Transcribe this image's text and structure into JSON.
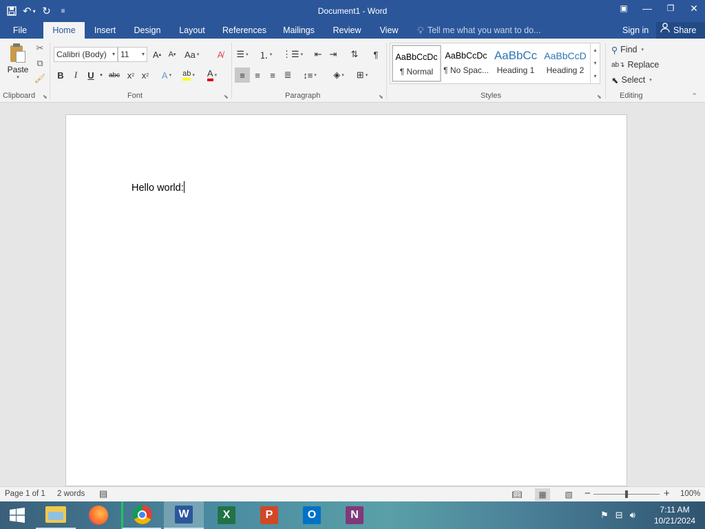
{
  "window": {
    "title": "Document1 - Word"
  },
  "tabs": [
    {
      "label": "File"
    },
    {
      "label": "Home"
    },
    {
      "label": "Insert"
    },
    {
      "label": "Design"
    },
    {
      "label": "Layout"
    },
    {
      "label": "References"
    },
    {
      "label": "Mailings"
    },
    {
      "label": "Review"
    },
    {
      "label": "View"
    }
  ],
  "active_tab": "Home",
  "tell_me": {
    "placeholder": "Tell me what you want to do..."
  },
  "account": {
    "sign_in": "Sign in",
    "share": "Share"
  },
  "ribbon": {
    "clipboard": {
      "paste_label": "Paste",
      "group_label": "Clipboard"
    },
    "font": {
      "family": "Calibri (Body)",
      "size": "11",
      "group_label": "Font",
      "change_case": "Aa"
    },
    "paragraph": {
      "group_label": "Paragraph"
    },
    "styles": {
      "group_label": "Styles",
      "items": [
        {
          "preview": "AaBbCcDc",
          "name": "¶ Normal",
          "color": "#000000"
        },
        {
          "preview": "AaBbCcDc",
          "name": "¶ No Spac...",
          "color": "#000000"
        },
        {
          "preview": "AaBbCc",
          "name": "Heading 1",
          "color": "#2e74b5"
        },
        {
          "preview": "AaBbCcD",
          "name": "Heading 2",
          "color": "#2e74b5"
        }
      ]
    },
    "editing": {
      "group_label": "Editing",
      "find": "Find",
      "replace": "Replace",
      "select": "Select"
    }
  },
  "document": {
    "text": "Hello world:"
  },
  "status": {
    "page": "Page 1 of 1",
    "words": "2 words",
    "zoom": "100%"
  },
  "taskbar": {
    "apps": [
      {
        "name": "File Explorer",
        "icon": "folder-icon"
      },
      {
        "name": "Firefox",
        "icon": "firefox-icon"
      },
      {
        "name": "Chrome",
        "icon": "chrome-icon"
      },
      {
        "name": "Word",
        "icon": "word-icon",
        "letter": "W",
        "color": "#2b579a"
      },
      {
        "name": "Excel",
        "icon": "excel-icon",
        "letter": "X",
        "color": "#217346"
      },
      {
        "name": "PowerPoint",
        "icon": "powerpoint-icon",
        "letter": "P",
        "color": "#d24726"
      },
      {
        "name": "Outlook",
        "icon": "outlook-icon",
        "letter": "O",
        "color": "#0072c6"
      },
      {
        "name": "OneNote",
        "icon": "onenote-icon",
        "letter": "N",
        "color": "#80397b"
      }
    ],
    "time": "7:11 AM",
    "date": "10/21/2024"
  },
  "colors": {
    "brand": "#2b579a",
    "ribbon": "#f3f3f3",
    "canvas": "#e6e6e6"
  }
}
